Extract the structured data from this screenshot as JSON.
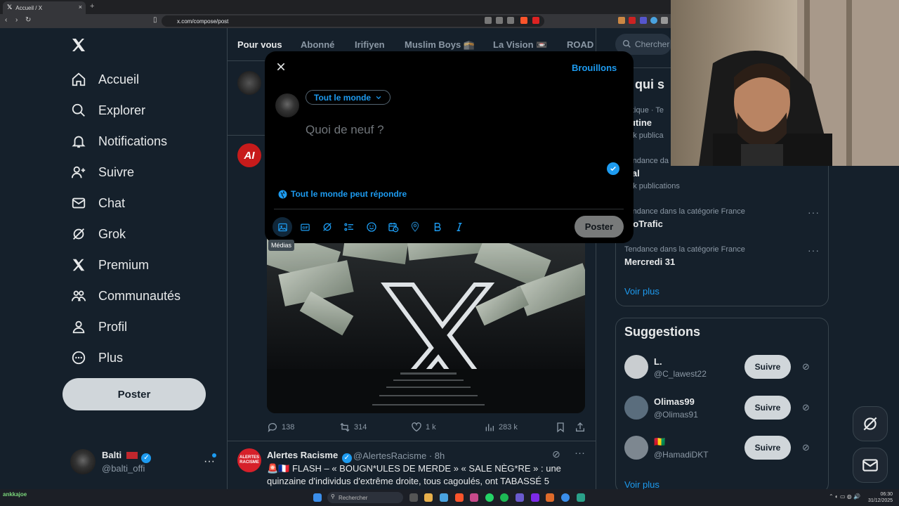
{
  "browser": {
    "tab_title": "Accueil / X",
    "tab_close": "×",
    "new_tab": "+",
    "url": "x.com/compose/post"
  },
  "sidebar": {
    "items": [
      {
        "label": "Accueil",
        "icon": "home-icon"
      },
      {
        "label": "Explorer",
        "icon": "search-icon"
      },
      {
        "label": "Notifications",
        "icon": "bell-icon"
      },
      {
        "label": "Suivre",
        "icon": "add-user-icon"
      },
      {
        "label": "Chat",
        "icon": "mail-icon"
      },
      {
        "label": "Grok",
        "icon": "grok-icon"
      },
      {
        "label": "Premium",
        "icon": "x-logo-icon"
      },
      {
        "label": "Communautés",
        "icon": "communities-icon"
      },
      {
        "label": "Profil",
        "icon": "user-icon"
      },
      {
        "label": "Plus",
        "icon": "more-circle-icon"
      }
    ],
    "post_button": "Poster",
    "profile": {
      "name": "Balti",
      "handle": "@balti_offi"
    }
  },
  "main": {
    "tabs": [
      "Pour vous",
      "Abonné",
      "Irifiyen",
      "Muslim Boys 🕋",
      "La Vision 📼",
      "ROAD"
    ],
    "tweet_actions": {
      "replies": "138",
      "reposts": "314",
      "likes": "1 k",
      "views": "283 k"
    },
    "tweet2": {
      "avatar_text": "ALERTES RACISME",
      "name": "Alertes Racisme",
      "handle": "@AlertesRacisme · 8h",
      "text": "🚨🇫🇷 FLASH – « BOUGN*ULES DE MERDE » « SALE NÈG*RE » : une quinzaine d'individus d'extrême droite, tous cagoulés, ont TABASSÉ 5"
    },
    "avatar_ai": "AI"
  },
  "right": {
    "search_placeholder": "Chercher",
    "trends_title": "e qui s",
    "trends": [
      {
        "category": "olitique · Te",
        "title": "outine",
        "count": ",4 k publica"
      },
      {
        "category": "Tendance da",
        "title": "alal",
        "count": ",8 k publications"
      },
      {
        "category": "Tendance dans la catégorie France",
        "title": "nfoTrafic",
        "count": ""
      },
      {
        "category": "Tendance dans la catégorie France",
        "title": "Mercredi 31",
        "count": ""
      }
    ],
    "more_link": "Voir plus",
    "suggestions_title": "Suggestions",
    "suggestions": [
      {
        "name": "L.",
        "handle": "@C_lawest22",
        "button": "Suivre"
      },
      {
        "name": "Olimas99",
        "handle": "@Olimas91",
        "button": "Suivre"
      },
      {
        "name": "🇬🇳",
        "handle": "@HamadiDKT",
        "button": "Suivre"
      }
    ],
    "suggestions_more": "Voir plus"
  },
  "compose": {
    "drafts": "Brouillons",
    "audience": "Tout le monde",
    "placeholder": "Quoi de neuf ?",
    "reply_setting": "Tout le monde peut répondre",
    "post_button": "Poster",
    "tooltip": "Médias"
  },
  "taskbar": {
    "search": "Rechercher",
    "time": "06:30",
    "date": "31/12/2025",
    "left_label": "ankkajoe"
  },
  "colors": {
    "accent": "#1d9bf0",
    "background": "#15202b",
    "modal": "#000000"
  }
}
